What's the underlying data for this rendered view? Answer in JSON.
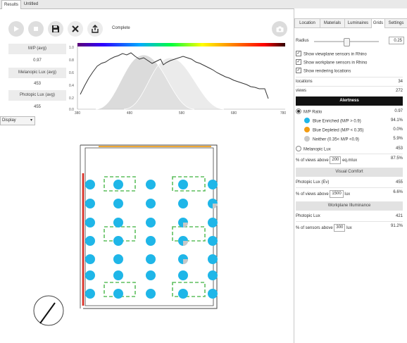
{
  "window_tabs": [
    "Results",
    "Untitled"
  ],
  "toolbar": {
    "status": "Complete",
    "buttons": [
      "play-icon",
      "stop-icon",
      "save-icon",
      "close-icon",
      "export-icon",
      "camera-icon"
    ]
  },
  "stats": [
    {
      "label": "M/P (avg)",
      "value": "0.97"
    },
    {
      "label": "Melanopic Lux (avg)",
      "value": "453"
    },
    {
      "label": "Photopic Lux (avg)",
      "value": "455"
    }
  ],
  "chart": {
    "y_ticks": [
      "1.0",
      "0.8",
      "0.6",
      "0.4",
      "0.2",
      "0.0"
    ],
    "x_ticks": [
      "380",
      "480",
      "580",
      "680",
      "780"
    ]
  },
  "display": {
    "label": "Display",
    "arrow": "▾"
  },
  "right_tabs": [
    "Location",
    "Materials",
    "Luminaires",
    "Grids",
    "Settings"
  ],
  "radius": {
    "label": "Radius",
    "value": "0.25",
    "slider_fraction": 0.5
  },
  "checkboxes": [
    {
      "label": "Show viewplane sensors in Rhino",
      "checked": true
    },
    {
      "label": "Show workplane sensors in Rhino",
      "checked": true
    },
    {
      "label": "Show rendering locations",
      "checked": true
    }
  ],
  "counts": [
    {
      "label": "locations",
      "value": "34"
    },
    {
      "label": "views",
      "value": "272"
    }
  ],
  "alertness": {
    "title": "Alertness",
    "mp_ratio": {
      "label": "M/P Ratio",
      "value": "0.97",
      "selected": true
    },
    "legend": [
      {
        "label": "Blue Enriched (M/P > 0.9)",
        "value": "94.1%",
        "color": "#1fb6e8"
      },
      {
        "label": "Blue Depleted (M/P < 0.35)",
        "value": "0.0%",
        "color": "#f39c12"
      },
      {
        "label": "Neither (0.35< M/P <0.9)",
        "value": "5.9%",
        "color": "#c8c8c8"
      }
    ],
    "melanopic": {
      "label": "Melanopic Lux",
      "value": "453"
    },
    "threshold": {
      "prefix": "% of views above",
      "input": "200",
      "unit": "eq.mlux",
      "value": "87.5%"
    }
  },
  "visual_comfort": {
    "title": "Visual Comfort",
    "photopic": {
      "label": "Photopic Lux (Ev)",
      "value": "455"
    },
    "threshold": {
      "prefix": "% of views above",
      "input": "1500",
      "unit": "lux",
      "value": "6.6%"
    }
  },
  "workplane": {
    "title": "Workplane Illuminance",
    "photopic": {
      "label": "Photopic Lux",
      "value": "421"
    },
    "threshold": {
      "prefix": "% of sensors above",
      "input": "300",
      "unit": "lux",
      "value": "91.2%"
    }
  },
  "colors": {
    "accent": "#1fb6e8",
    "window_red": "#d9261c",
    "window_orange": "#f0a733",
    "desk_green": "#5fbf5f"
  }
}
